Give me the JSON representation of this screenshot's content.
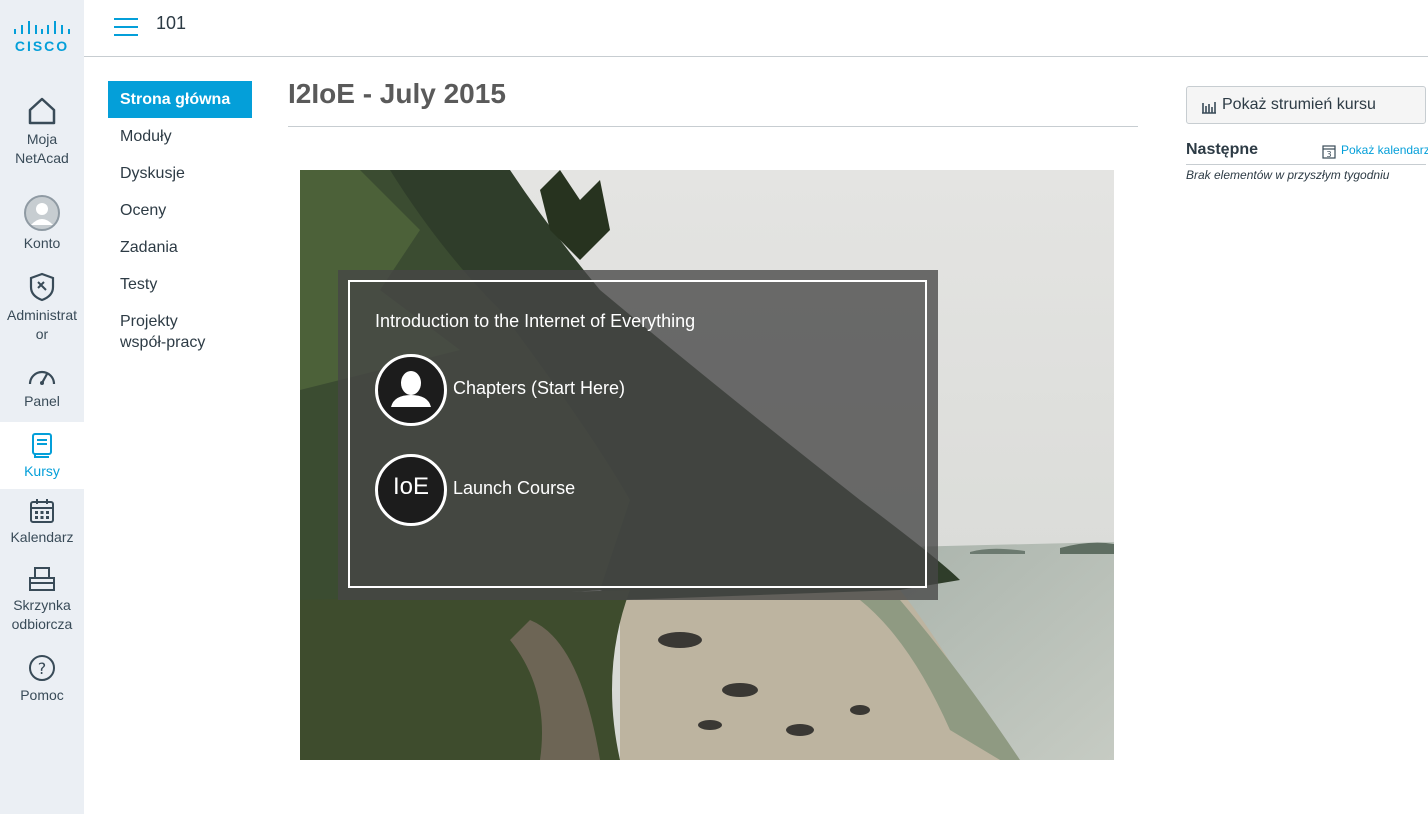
{
  "logo": {
    "text": "CISCO"
  },
  "global_nav": {
    "items": [
      {
        "label": "Moja NetAcad",
        "icon": "home-icon"
      },
      {
        "label": "Konto",
        "icon": "avatar-icon"
      },
      {
        "label": "Administrator",
        "icon": "admin-shield-icon"
      },
      {
        "label": "Panel",
        "icon": "dashboard-icon"
      },
      {
        "label": "Kursy",
        "icon": "courses-icon",
        "active": true
      },
      {
        "label": "Kalendarz",
        "icon": "calendar-icon"
      },
      {
        "label": "Skrzynka odbiorcza",
        "icon": "inbox-icon"
      },
      {
        "label": "Pomoc",
        "icon": "help-icon"
      }
    ]
  },
  "header": {
    "breadcrumb": "101"
  },
  "course_nav": {
    "items": [
      {
        "label": "Strona główna",
        "active": true
      },
      {
        "label": "Moduły"
      },
      {
        "label": "Dyskusje"
      },
      {
        "label": "Oceny"
      },
      {
        "label": "Zadania"
      },
      {
        "label": "Testy"
      },
      {
        "label": "Projekty współ-pracy"
      }
    ]
  },
  "main": {
    "title": "I2IoE - July 2015",
    "hero": {
      "heading": "Introduction to the Internet of Everything",
      "links": [
        {
          "label": "Chapters (Start Here)",
          "icon": "person-icon"
        },
        {
          "label": "Launch Course",
          "icon_text": "IoE"
        }
      ]
    }
  },
  "sidebar": {
    "stream_button": "Pokaż strumień kursu",
    "next_heading": "Następne",
    "calendar_link": "Pokaż kalendarz",
    "calendar_day": "3",
    "empty_text": "Brak elementów w przyszłym tygodniu"
  },
  "colors": {
    "accent": "#049fd9",
    "nav_bg": "#ebeff4",
    "text": "#2d3b45"
  }
}
